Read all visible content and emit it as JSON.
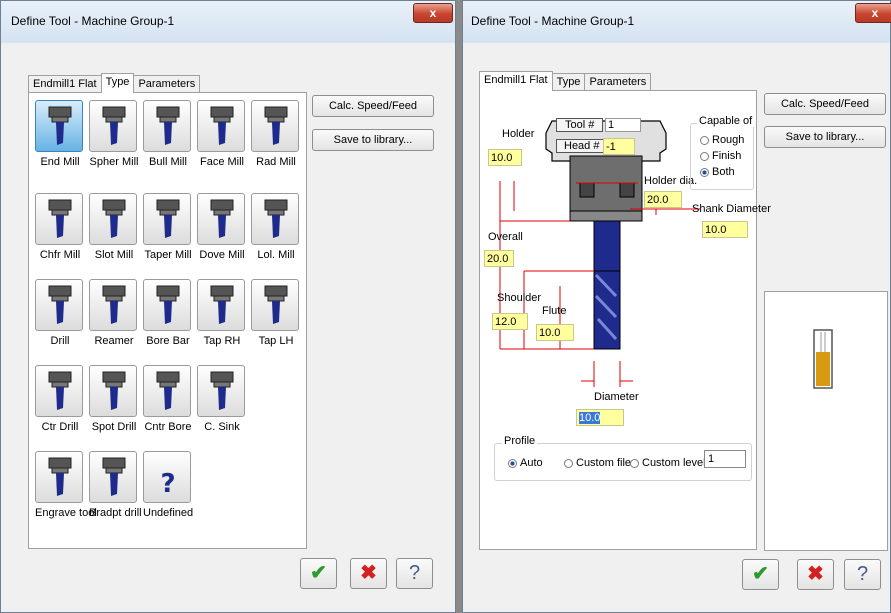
{
  "left_dialog": {
    "title": "Define Tool - Machine Group-1",
    "close_label": "x",
    "tabs": [
      "Endmill1 Flat",
      "Type",
      "Parameters"
    ],
    "tools": [
      {
        "label": "End Mill",
        "icon": "end-mill-icon"
      },
      {
        "label": "Spher Mill",
        "icon": "sphere-mill-icon"
      },
      {
        "label": "Bull Mill",
        "icon": "bull-mill-icon"
      },
      {
        "label": "Face Mill",
        "icon": "face-mill-icon"
      },
      {
        "label": "Rad Mill",
        "icon": "rad-mill-icon"
      },
      {
        "label": "Chfr Mill",
        "icon": "chamfer-mill-icon"
      },
      {
        "label": "Slot Mill",
        "icon": "slot-mill-icon"
      },
      {
        "label": "Taper Mill",
        "icon": "taper-mill-icon"
      },
      {
        "label": "Dove Mill",
        "icon": "dove-mill-icon"
      },
      {
        "label": "Lol. Mill",
        "icon": "lollipop-mill-icon"
      },
      {
        "label": "Drill",
        "icon": "drill-icon"
      },
      {
        "label": "Reamer",
        "icon": "reamer-icon"
      },
      {
        "label": "Bore Bar",
        "icon": "bore-bar-icon"
      },
      {
        "label": "Tap RH",
        "icon": "tap-rh-icon"
      },
      {
        "label": "Tap LH",
        "icon": "tap-lh-icon"
      },
      {
        "label": "Ctr Drill",
        "icon": "center-drill-icon"
      },
      {
        "label": "Spot Drill",
        "icon": "spot-drill-icon"
      },
      {
        "label": "Cntr Bore",
        "icon": "counterbore-icon"
      },
      {
        "label": "C. Sink",
        "icon": "countersink-icon"
      },
      {
        "label": "Engrave tool",
        "icon": "engrave-tool-icon"
      },
      {
        "label": "Bradpt drill",
        "icon": "bradpoint-drill-icon"
      },
      {
        "label": "Undefined",
        "icon": "undefined-tool-icon"
      }
    ],
    "selected_tool": "End Mill",
    "calc_button": "Calc. Speed/Feed",
    "save_button": "Save to library..."
  },
  "right_dialog": {
    "title": "Define Tool - Machine Group-1",
    "close_label": "x",
    "tabs": [
      "Endmill1 Flat",
      "Type",
      "Parameters"
    ],
    "tool_number_label": "Tool #",
    "tool_number_value": "1",
    "head_number_label": "Head #",
    "head_number_value": "-1",
    "holder_label": "Holder",
    "holder_value": "10.0",
    "holder_dia_label": "Holder dia.",
    "holder_dia_value": "20.0",
    "shank_label": "Shank Diameter",
    "shank_value": "10.0",
    "overall_label": "Overall",
    "overall_value": "20.0",
    "shoulder_label": "Shoulder",
    "shoulder_value": "12.0",
    "flute_label": "Flute",
    "flute_value": "10.0",
    "diameter_label": "Diameter",
    "diameter_value": "10.0",
    "capable_of": {
      "label": "Capable of",
      "options": [
        "Rough",
        "Finish",
        "Both"
      ],
      "selected": "Both"
    },
    "profile": {
      "label": "Profile",
      "options": [
        "Auto",
        "Custom file",
        "Custom level"
      ],
      "selected": "Auto",
      "level_value": "1"
    },
    "calc_button": "Calc. Speed/Feed",
    "save_button": "Save to library..."
  },
  "colors": {
    "tool_blue": "#1e2a8c",
    "field_yellow": "#ffffa0",
    "dimension_red": "#e00000",
    "selected_tool_bg": "#66b3e4",
    "preview_gold": "#d89a10"
  }
}
